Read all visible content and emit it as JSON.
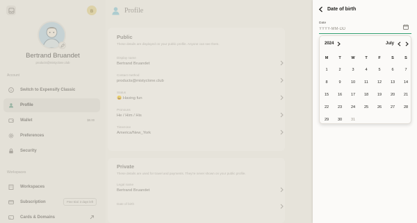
{
  "sidebar": {
    "profile_initial": "ʙ",
    "display_name": "Bertrand Bruandet",
    "email": "products@mistyclone.club",
    "account_section": "Account",
    "workspaces_section": "Workspaces",
    "items": [
      {
        "label": "Switch to Expensify Classic"
      },
      {
        "label": "Profile"
      },
      {
        "label": "Wallet",
        "badge": "$0.00"
      },
      {
        "label": "Preferences"
      },
      {
        "label": "Security"
      },
      {
        "label": "Workspaces"
      },
      {
        "label": "Subscription",
        "badge": "Free trial: 3 days left"
      },
      {
        "label": "Cards & Domains"
      }
    ]
  },
  "main": {
    "page_title": "Profile",
    "public": {
      "title": "Public",
      "description": "These details are displayed on your public profile. Anyone can see them.",
      "fields": [
        {
          "label": "Display name",
          "value": "Bertrand Bruandet"
        },
        {
          "label": "Contact method",
          "value": "products@mistyclone.club"
        },
        {
          "label": "Status",
          "value": "😀 Having fun"
        },
        {
          "label": "Pronouns",
          "value": "He / Him / His"
        },
        {
          "label": "Timezone",
          "value": "America/New_York"
        }
      ]
    },
    "private": {
      "title": "Private",
      "description": "These details are used for travel and payments. They're never shown on your public profile.",
      "fields": [
        {
          "label": "Legal name",
          "value": "Bertrand Bruandet"
        },
        {
          "label": "Date of birth",
          "value": ""
        }
      ]
    }
  },
  "rhp": {
    "title": "Date of birth",
    "date_label": "Date",
    "date_placeholder": "YYYY-MM-DD",
    "date_value": ""
  },
  "calendar": {
    "year": "2024",
    "month": "July",
    "weekdays": [
      "M",
      "T",
      "W",
      "T",
      "F",
      "S",
      "S"
    ],
    "weeks": [
      [
        "1",
        "2",
        "3",
        "4",
        "5",
        "6",
        "7"
      ],
      [
        "8",
        "9",
        "10",
        "11",
        "12",
        "13",
        "14"
      ],
      [
        "15",
        "16",
        "17",
        "18",
        "19",
        "20",
        "21"
      ],
      [
        "22",
        "23",
        "24",
        "25",
        "26",
        "27",
        "28"
      ],
      [
        "29",
        "30",
        "31",
        "",
        "",
        "",
        ""
      ]
    ],
    "disabled_days": [
      "31"
    ]
  },
  "colors": {
    "accent_green": "#2f9e6e",
    "background": "#e6e3db",
    "panel": "#fbfaf8"
  }
}
